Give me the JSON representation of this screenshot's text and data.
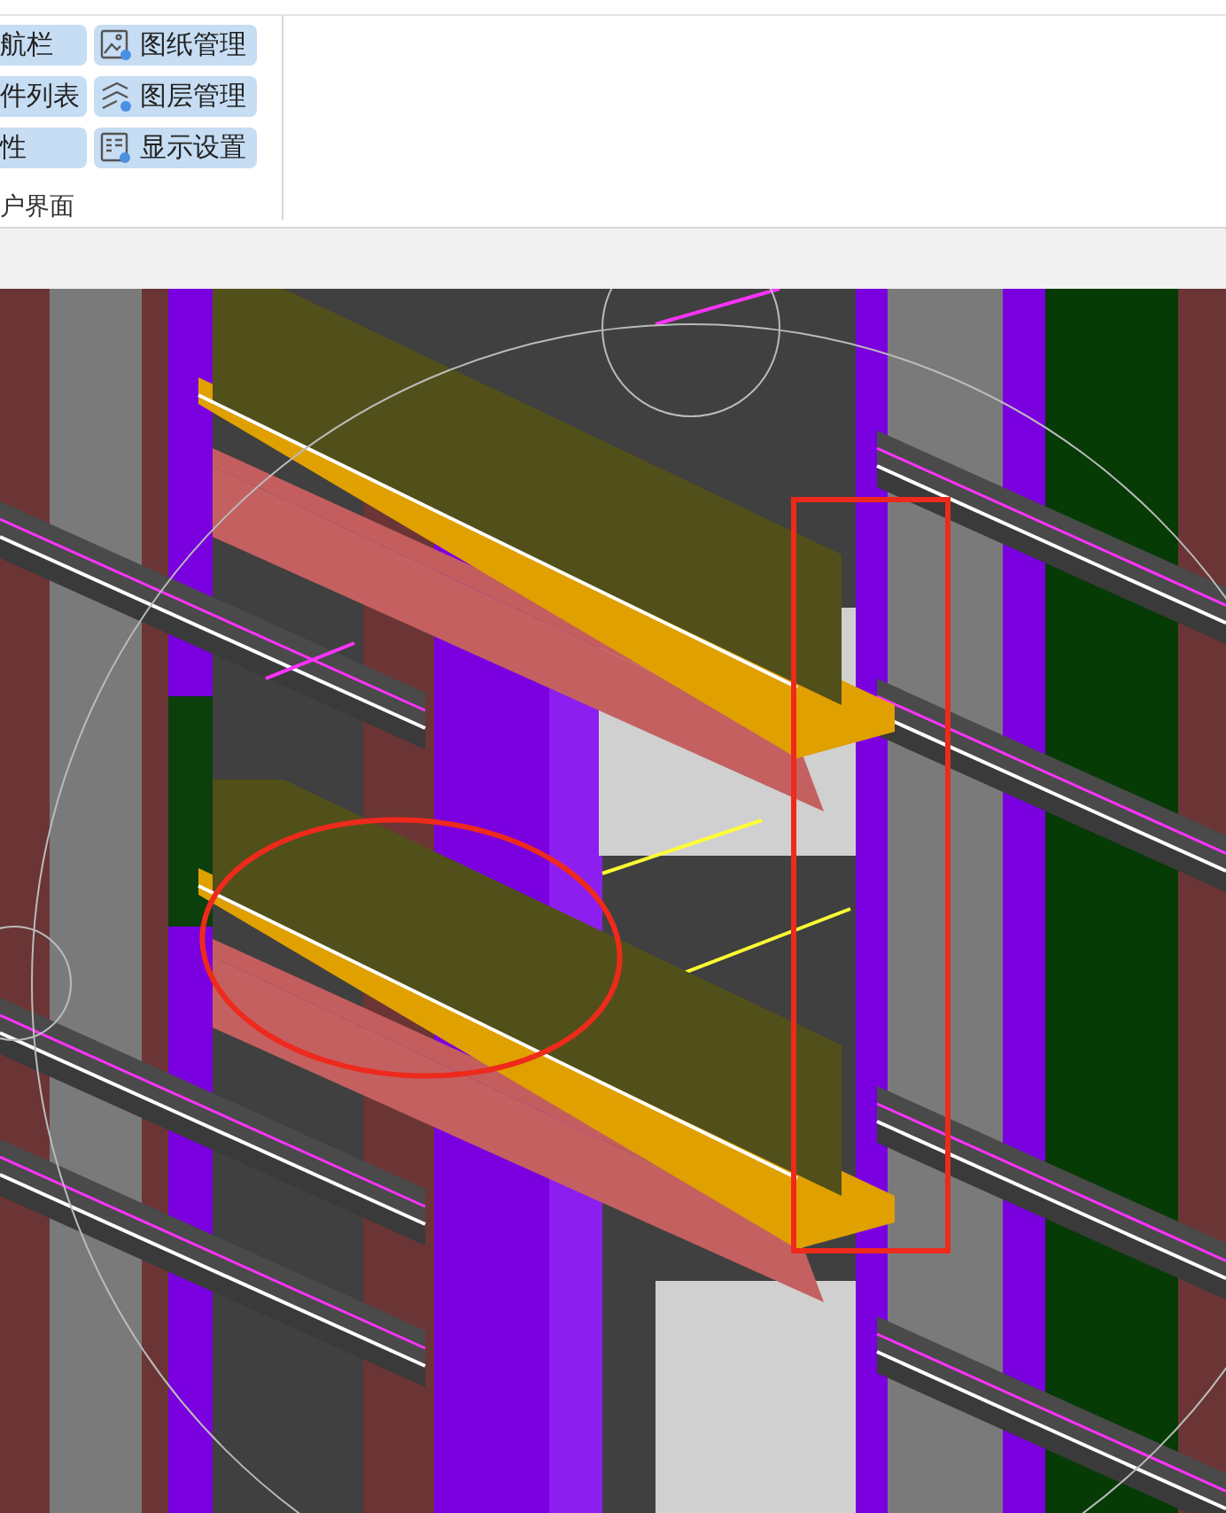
{
  "ribbon": {
    "columns": [
      {
        "buttons": [
          {
            "label": "航栏"
          },
          {
            "label": "件列表"
          },
          {
            "label": "性"
          }
        ]
      },
      {
        "buttons": [
          {
            "label": "图纸管理",
            "kind": "sheet"
          },
          {
            "label": "图层管理",
            "kind": "layers"
          },
          {
            "label": "显示设置",
            "kind": "display"
          }
        ]
      }
    ],
    "group_label": "户界面"
  }
}
